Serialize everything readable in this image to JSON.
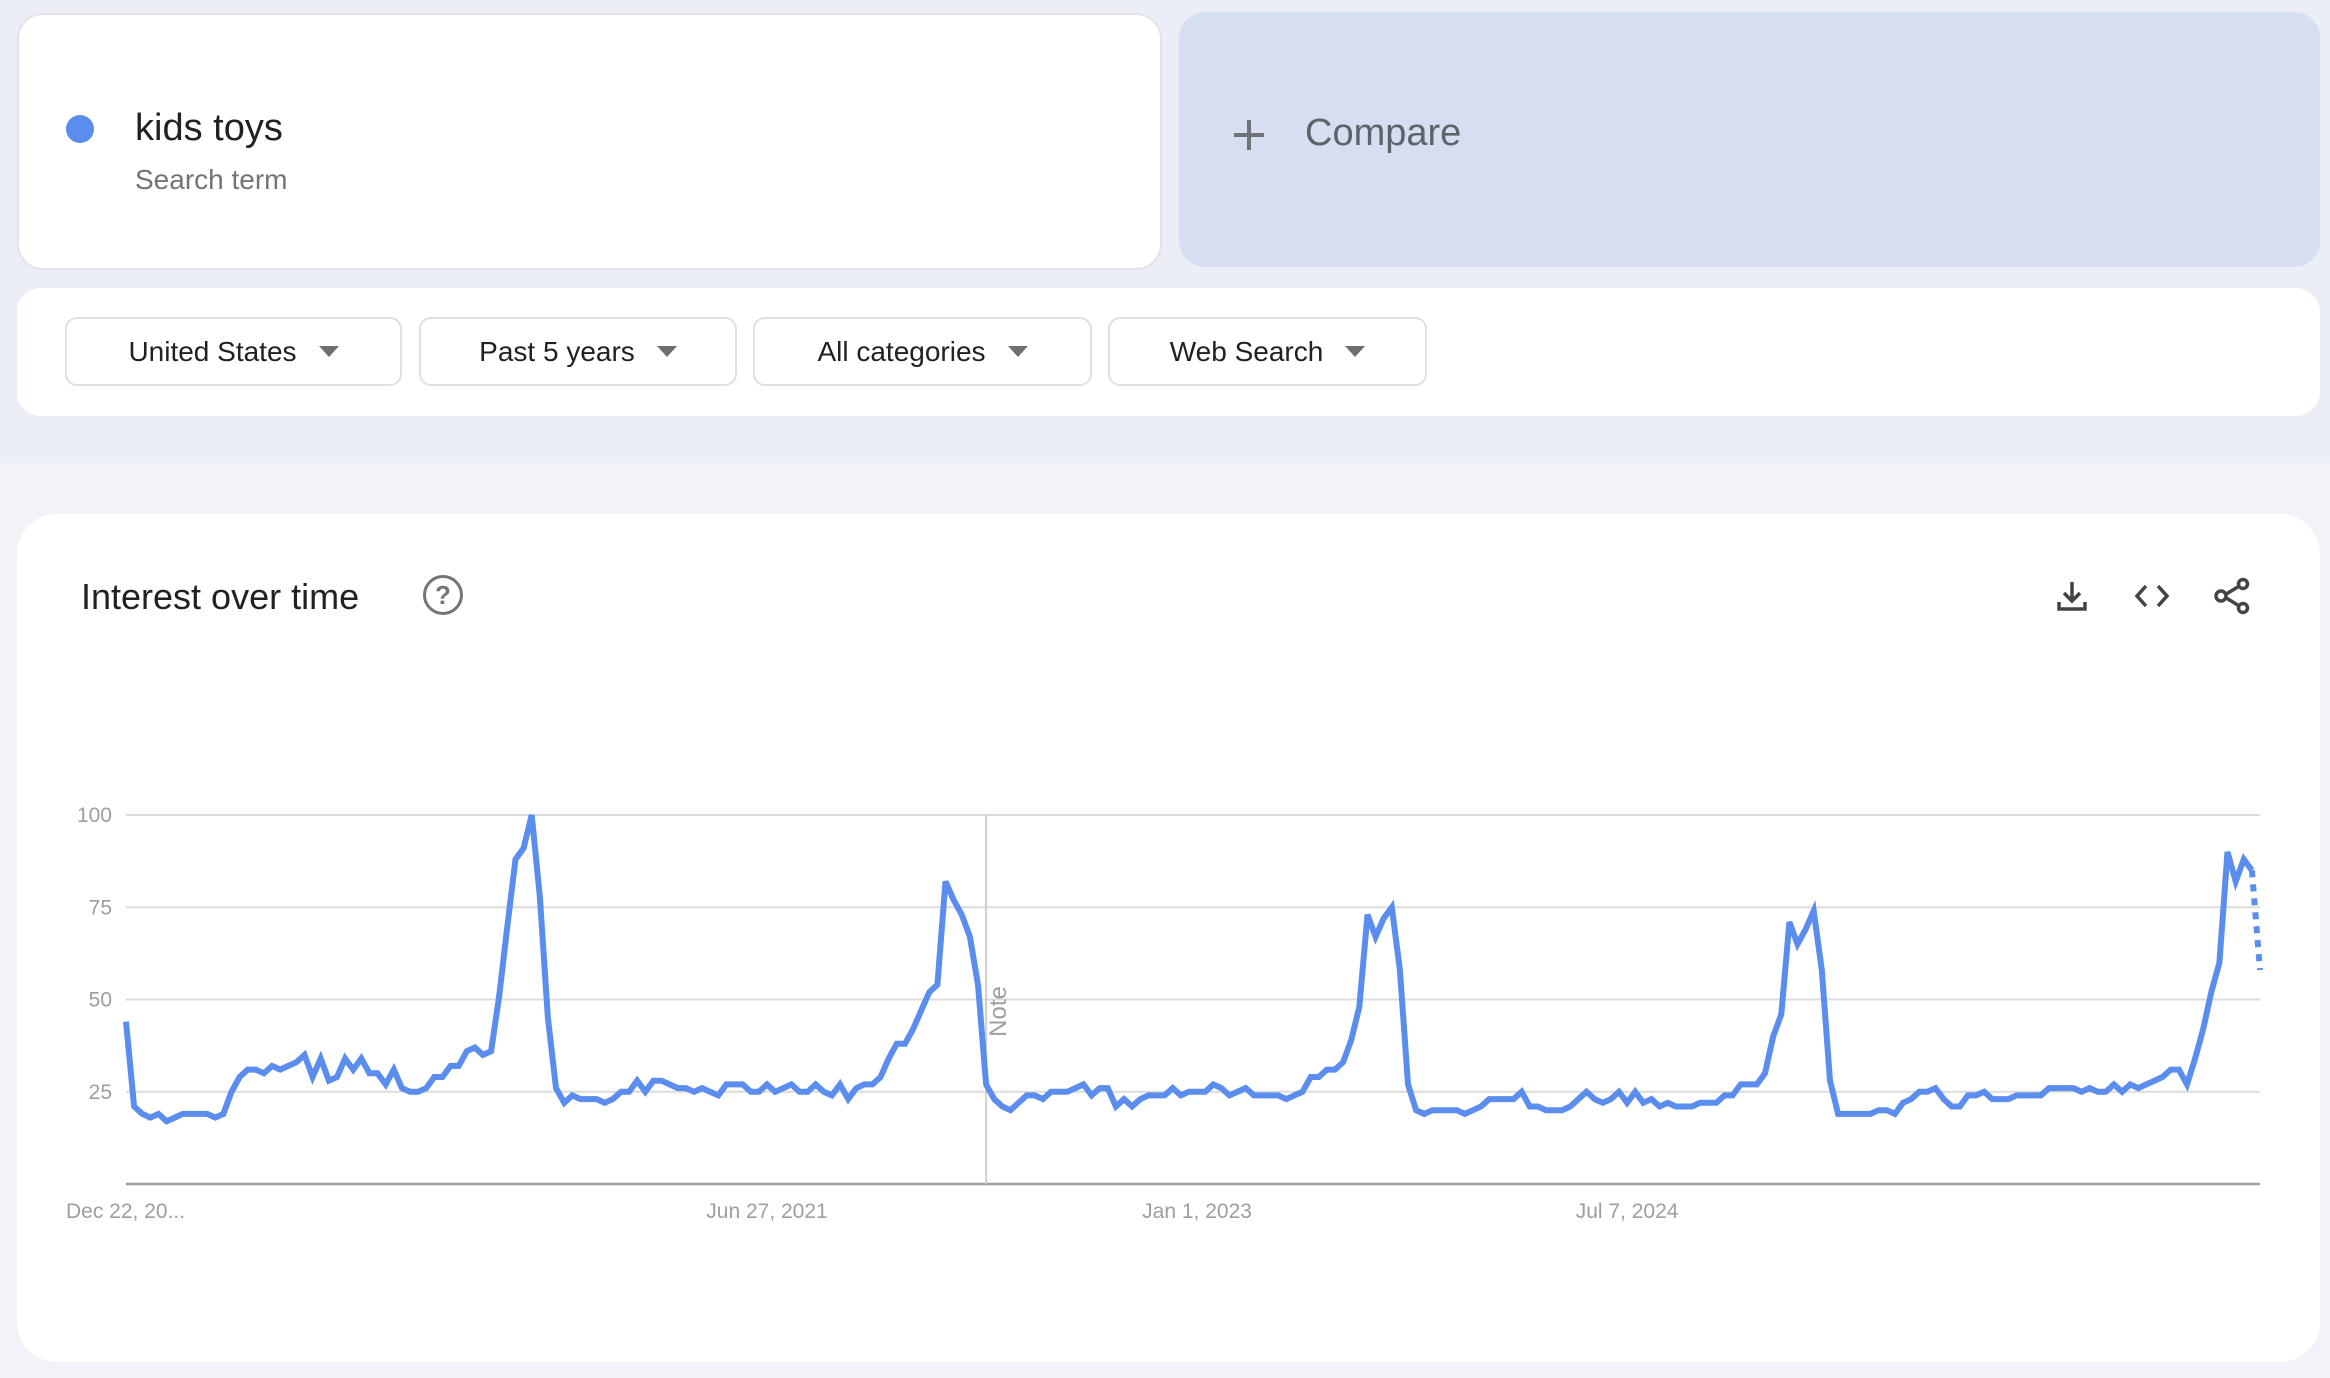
{
  "search_term": {
    "name": "kids toys",
    "subtitle": "Search term",
    "color": "#5a8dee"
  },
  "compare": {
    "label": "Compare",
    "icon": "plus-icon"
  },
  "filters": [
    {
      "label": "United States",
      "icon": "caret-down-icon"
    },
    {
      "label": "Past 5 years",
      "icon": "caret-down-icon"
    },
    {
      "label": "All categories",
      "icon": "caret-down-icon"
    },
    {
      "label": "Web Search",
      "icon": "caret-down-icon"
    }
  ],
  "panel": {
    "title": "Interest over time",
    "help_icon": "help-circle-icon",
    "help_glyph": "?",
    "actions": [
      "download-icon",
      "embed-code-icon",
      "share-icon"
    ]
  },
  "chart_data": {
    "type": "line",
    "title": "Interest over time",
    "xlabel": "",
    "ylabel": "",
    "ylim": [
      0,
      100
    ],
    "y_ticks": [
      25,
      50,
      75,
      100
    ],
    "y_tick_labels": [
      "25",
      "50",
      "75",
      "100"
    ],
    "x_tick_labels": [
      {
        "label": "Dec 22, 20...",
        "week_index": 0,
        "anchor": "start"
      },
      {
        "label": "Jun 27, 2021",
        "week_index": 79,
        "anchor": "middle"
      },
      {
        "label": "Jan 1, 2023",
        "week_index": 132,
        "anchor": "middle"
      },
      {
        "label": "Jul 7, 2024",
        "week_index": 185,
        "anchor": "middle"
      }
    ],
    "grid": true,
    "interval": "weekly",
    "annotation": {
      "label": "Note",
      "week_index": 106
    },
    "partial_last_point": true,
    "series": [
      {
        "name": "kids toys",
        "color": "#5a8dee",
        "values": [
          44,
          21,
          19,
          18,
          19,
          17,
          18,
          19,
          19,
          19,
          19,
          18,
          19,
          25,
          29,
          31,
          31,
          30,
          32,
          31,
          32,
          33,
          35,
          29,
          34,
          28,
          29,
          34,
          31,
          34,
          30,
          30,
          27,
          31,
          26,
          25,
          25,
          26,
          29,
          29,
          32,
          32,
          36,
          37,
          35,
          36,
          51,
          70,
          88,
          91,
          100,
          78,
          45,
          26,
          22,
          24,
          23,
          23,
          23,
          22,
          23,
          25,
          25,
          28,
          25,
          28,
          28,
          27,
          26,
          26,
          25,
          26,
          25,
          24,
          27,
          27,
          27,
          25,
          25,
          27,
          25,
          26,
          27,
          25,
          25,
          27,
          25,
          24,
          27,
          23,
          26,
          27,
          27,
          29,
          34,
          38,
          38,
          42,
          47,
          52,
          54,
          82,
          77,
          73,
          67,
          54,
          27,
          23,
          21,
          20,
          22,
          24,
          24,
          23,
          25,
          25,
          25,
          26,
          27,
          24,
          26,
          26,
          21,
          23,
          21,
          23,
          24,
          24,
          24,
          26,
          24,
          25,
          25,
          25,
          27,
          26,
          24,
          25,
          26,
          24,
          24,
          24,
          24,
          23,
          24,
          25,
          29,
          29,
          31,
          31,
          33,
          39,
          48,
          73,
          67,
          72,
          75,
          58,
          27,
          20,
          19,
          20,
          20,
          20,
          20,
          19,
          20,
          21,
          23,
          23,
          23,
          23,
          25,
          21,
          21,
          20,
          20,
          20,
          21,
          23,
          25,
          23,
          22,
          23,
          25,
          22,
          25,
          22,
          23,
          21,
          22,
          21,
          21,
          21,
          22,
          22,
          22,
          24,
          24,
          27,
          27,
          27,
          30,
          40,
          46,
          71,
          65,
          69,
          74,
          58,
          28,
          19,
          19,
          19,
          19,
          19,
          20,
          20,
          19,
          22,
          23,
          25,
          25,
          26,
          23,
          21,
          21,
          24,
          24,
          25,
          23,
          23,
          23,
          24,
          24,
          24,
          24,
          26,
          26,
          26,
          26,
          25,
          26,
          25,
          25,
          27,
          25,
          27,
          26,
          27,
          28,
          29,
          31,
          31,
          27,
          34,
          42,
          52,
          60,
          90,
          82,
          88,
          85,
          58
        ]
      }
    ]
  }
}
